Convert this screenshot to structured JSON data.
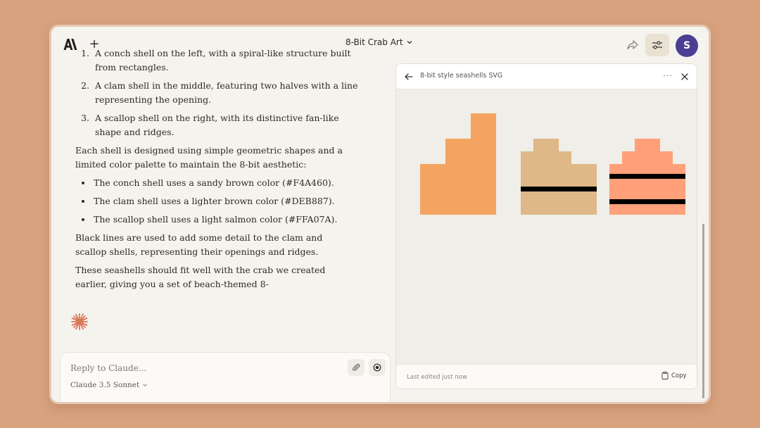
{
  "header": {
    "title": "8-Bit Crab Art",
    "avatar_initial": "S"
  },
  "chat": {
    "shells_list": [
      "A conch shell on the left, with a spiral-like structure built from rectangles.",
      "A clam shell in the middle, featuring two halves with a line representing the opening.",
      "A scallop shell on the right, with its distinctive fan-like shape and ridges."
    ],
    "paragraph_design": "Each shell is designed using simple geometric shapes and a limited color palette to maintain the 8-bit aesthetic:",
    "colors_list": [
      "The conch shell uses a sandy brown color (#F4A460).",
      "The clam shell uses a lighter brown color (#DEB887).",
      "The scallop shell uses a light salmon color (#FFA07A)."
    ],
    "paragraph_lines": "Black lines are used to add some detail to the clam and scallop shells, representing their openings and ridges.",
    "paragraph_fit": "These seashells should fit well with the crab we created earlier, giving you a set of beach-themed 8-"
  },
  "reply": {
    "placeholder": "Reply to Claude...",
    "model": "Claude 3.5 Sonnet"
  },
  "artifact": {
    "title": "8-bit style seashells SVG",
    "footer": "Last edited just now",
    "copy_label": "Copy",
    "colors": {
      "conch": "#F4A460",
      "clam": "#DEB887",
      "scallop": "#FFA07A",
      "line": "#000000"
    }
  },
  "colors": {
    "page_bg": "#d9a27e",
    "window_bg": "#f5f3ee",
    "avatar": "#4a3f93",
    "accent_spark": "#d97757"
  }
}
